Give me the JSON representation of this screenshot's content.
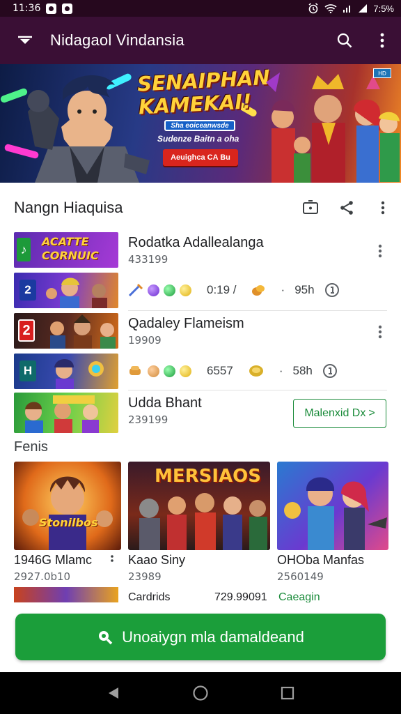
{
  "status_bar": {
    "time": "11:36",
    "battery": "7:5%"
  },
  "app_bar": {
    "title": "Nidagaol Vindansia"
  },
  "banner": {
    "headline": "SENAIPHAN KAMEKAI!",
    "pill": "Sha eoiceanwsde",
    "subline": "Sudenze Baitn a oha",
    "cta": "Aeuighca CA Bu",
    "badge": "HD"
  },
  "section": {
    "title": "Nangn Hiaquisa"
  },
  "list": [
    {
      "thumb_text": "ACATTE CORNUIC",
      "name": "Rodatka Adallealanga",
      "count": "433199",
      "stats_label": "0:19 /",
      "time": "95h",
      "thumb2_tag": "2"
    },
    {
      "thumb_text": "2",
      "name": "Qadaley Flameism",
      "count": "19909",
      "stats_label": "6557",
      "time": "58h",
      "thumb2_tag": "H"
    },
    {
      "name": "Udda Bhant",
      "count": "239199",
      "button": "Malenxid Dx",
      "button_arrow": ">"
    }
  ],
  "features": {
    "label": "Fenis",
    "cards": [
      {
        "title": "1946G Mlamc",
        "sub": "2927.0b10",
        "img_text": "Stonilbos"
      },
      {
        "title": "Kaao Siny",
        "sub": "23989",
        "img_text": "MERSIAOS"
      },
      {
        "title": "OHOba Manfas",
        "sub": "2560149",
        "img_text": ""
      }
    ]
  },
  "partial": {
    "a": "Cardrids",
    "b": "729.99091",
    "c": "Caeagin"
  },
  "download": {
    "label": "Unoaiygn mla damaldeand"
  },
  "colors": {
    "app_bar": "#3a0f35",
    "accent_green": "#1b9e3a",
    "status_bar": "#26081e"
  }
}
